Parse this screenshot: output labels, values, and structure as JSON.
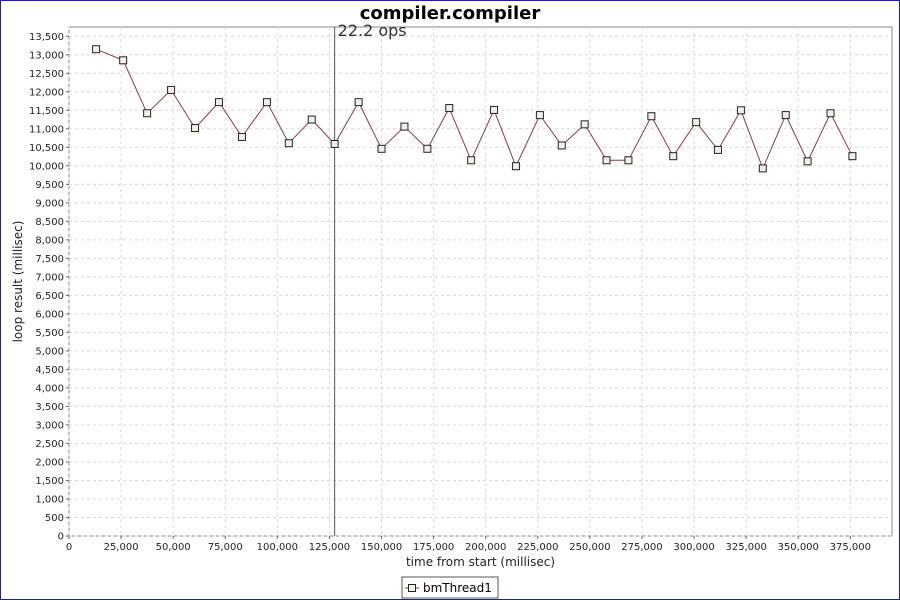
{
  "chart_data": {
    "type": "line",
    "title": "compiler.compiler",
    "xlabel": "time from start (millisec)",
    "ylabel": "loop result (millisec)",
    "xlim": [
      0,
      395000
    ],
    "ylim": [
      0,
      13750
    ],
    "x_ticks": [
      0,
      25000,
      50000,
      75000,
      100000,
      125000,
      150000,
      175000,
      200000,
      225000,
      250000,
      275000,
      300000,
      325000,
      350000,
      375000
    ],
    "x_tick_labels": [
      "0",
      "25,000",
      "50,000",
      "75,000",
      "100,000",
      "125,000",
      "150,000",
      "175,000",
      "200,000",
      "225,000",
      "250,000",
      "275,000",
      "300,000",
      "325,000",
      "350,000",
      "375,000"
    ],
    "y_ticks": [
      0,
      500,
      1000,
      1500,
      2000,
      2500,
      3000,
      3500,
      4000,
      4500,
      5000,
      5500,
      6000,
      6500,
      7000,
      7500,
      8000,
      8500,
      9000,
      9500,
      10000,
      10500,
      11000,
      11500,
      12000,
      12500,
      13000,
      13500
    ],
    "y_tick_labels": [
      "0",
      "500",
      "1,000",
      "1,500",
      "2,000",
      "2,500",
      "3,000",
      "3,500",
      "4,000",
      "4,500",
      "5,000",
      "5,500",
      "6,000",
      "6,500",
      "7,000",
      "7,500",
      "8,000",
      "8,500",
      "9,000",
      "9,500",
      "10,000",
      "10,500",
      "11,000",
      "11,500",
      "12,000",
      "12,500",
      "13,000",
      "13,500"
    ],
    "grid": true,
    "legend_position": "bottom-center",
    "marker_line": {
      "x": 127500,
      "label": "22.2 ops"
    },
    "series": [
      {
        "name": "bmThread1",
        "color": "#8b3a3a",
        "marker": "square",
        "x": [
          13000,
          26000,
          37500,
          49000,
          60500,
          72000,
          83000,
          95000,
          105500,
          116500,
          127500,
          139000,
          150000,
          161000,
          172000,
          182500,
          193000,
          204000,
          214500,
          226000,
          236500,
          247500,
          258000,
          268500,
          279500,
          290000,
          301000,
          311500,
          322500,
          333000,
          344000,
          354500,
          365500,
          376000
        ],
        "values": [
          13150,
          12850,
          11420,
          12050,
          11020,
          11720,
          10780,
          11720,
          10610,
          11250,
          10590,
          11720,
          10460,
          11060,
          10460,
          11560,
          10150,
          11510,
          9990,
          11370,
          10550,
          11120,
          10150,
          10150,
          11340,
          10260,
          11180,
          10430,
          11500,
          9930,
          11370,
          10120,
          11420,
          10260
        ]
      }
    ]
  }
}
